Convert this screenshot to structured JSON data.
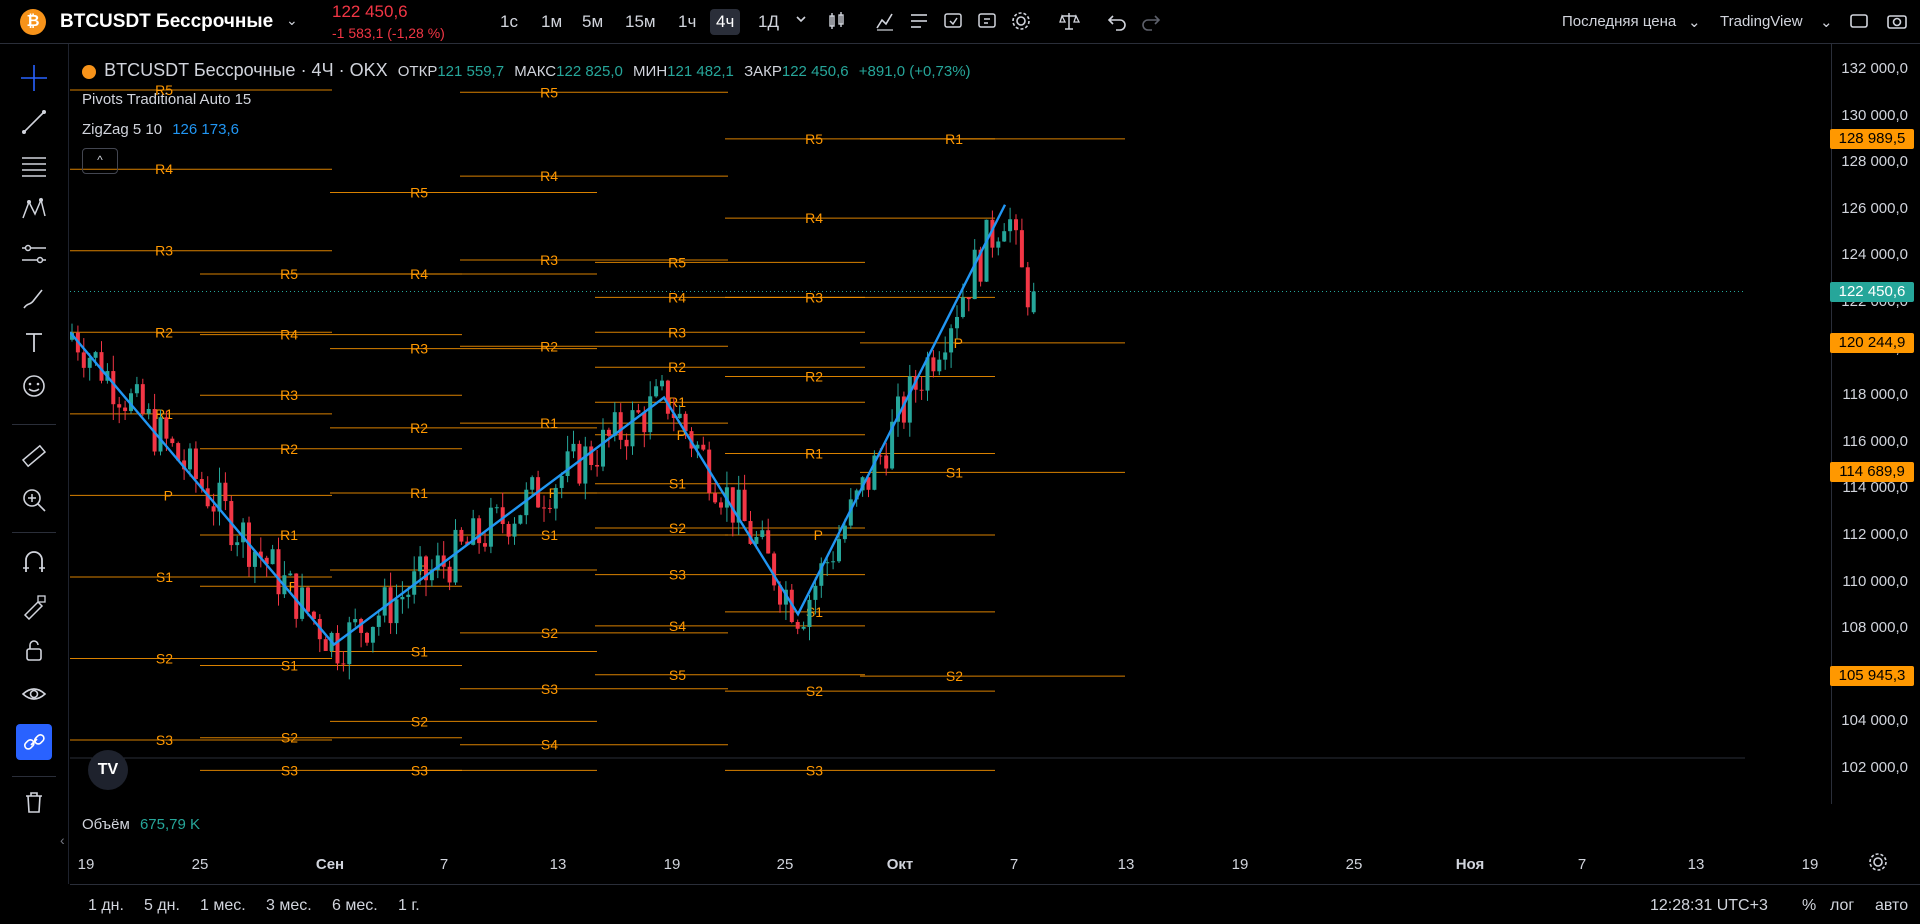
{
  "header": {
    "symbol_logo": "₿",
    "symbol_name": "BTCUSDT Бессрочные",
    "last_price": "122 450,6",
    "change": "-1 583,1 (-1,28 %)",
    "timeframes": [
      "1с",
      "1м",
      "5м",
      "15м",
      "1ч",
      "4ч",
      "1Д"
    ],
    "active_timeframe": "4ч",
    "price_type": "Последняя цена",
    "source": "TradingView"
  },
  "legend": {
    "title": "BTCUSDT Бессрочные · 4Ч · OKX",
    "open_label": "ОТКР",
    "open": "121 559,7",
    "high_label": "МАКС",
    "high": "122 825,0",
    "low_label": "МИН",
    "low": "121 482,1",
    "close_label": "ЗАКР",
    "close": "122 450,6",
    "change": "+891,0 (+0,73%)",
    "pivots": "Pivots Traditional Auto 15",
    "zigzag": "ZigZag 5 10",
    "zigzag_value": "126 173,6",
    "collapse": "^"
  },
  "volume": {
    "label": "Объём",
    "value": "675,79 K"
  },
  "price_axis": {
    "ticks": [
      "132 000,0",
      "130 000,0",
      "128 000,0",
      "126 000,0",
      "124 000,0",
      "122 000,0",
      "120 000,0",
      "118 000,0",
      "116 000,0",
      "114 000,0",
      "112 000,0",
      "110 000,0",
      "108 000,0",
      "106 000,0",
      "104 000,0",
      "102 000,0"
    ],
    "badges": [
      {
        "text": "128 989,5",
        "color": "#ff9800"
      },
      {
        "text": "122 450,6",
        "color": "#26a69a"
      },
      {
        "text": "120 244,9",
        "color": "#ff9800"
      },
      {
        "text": "114 689,9",
        "color": "#ff9800"
      },
      {
        "text": "105 945,3",
        "color": "#ff9800"
      }
    ]
  },
  "time_axis": [
    "19",
    "25",
    "Сен",
    "7",
    "13",
    "19",
    "25",
    "Окт",
    "7",
    "13",
    "19",
    "25",
    "Ноя",
    "7",
    "13",
    "19"
  ],
  "ranges": [
    "1 дн.",
    "5 дн.",
    "1 мес.",
    "3 мес.",
    "6 мес.",
    "1 г."
  ],
  "clock": "12:28:31 UTC+3",
  "scale_buttons": {
    "percent": "%",
    "log": "лог",
    "auto": "авто"
  },
  "tv_logo": "TV",
  "colors": {
    "up": "#26a69a",
    "down": "#f23645",
    "pivot": "#ff9800",
    "zigzag": "#2196f3",
    "badge_last": "#26a69a"
  },
  "chart_data": {
    "type": "candlestick",
    "timeframe": "4ч",
    "ylim": [
      101000,
      133000
    ],
    "pivot_labels": [
      "R5",
      "R4",
      "R3",
      "R2",
      "R1",
      "P",
      "S1",
      "S2",
      "S3",
      "S4",
      "S5"
    ],
    "zigzag": [
      {
        "date": "16 Авг",
        "y": 120700
      },
      {
        "date": "1 Сен",
        "y": 107300
      },
      {
        "date": "18 Сен",
        "y": 117900
      },
      {
        "date": "25 Сен",
        "y": 108600
      },
      {
        "date": "6 Окт",
        "y": 126173.6
      }
    ],
    "pivot_periods": [
      {
        "levels": {
          "R5": 131100,
          "R4": 127700,
          "R3": 124200,
          "R2": 120700,
          "R1": 117200,
          "P": 113700,
          "S1": 110200,
          "S2": 106700,
          "S3": 103200
        }
      },
      {
        "levels": {
          "R5": 123200,
          "R4": 120600,
          "R3": 118000,
          "R2": 115700,
          "R1": 112000,
          "P": 109800,
          "S1": 106400,
          "S2": 103300,
          "S3": 101900
        }
      },
      {
        "levels": {
          "R5": 126700,
          "R4": 123200,
          "R3": 120000,
          "R2": 116600,
          "R1": 113800,
          "P": 110500,
          "S1": 107000,
          "S2": 104000,
          "S3": 101900
        }
      },
      {
        "levels": {
          "R5": 131000,
          "R4": 127400,
          "R3": 123800,
          "R2": 120100,
          "R1": 116800,
          "P": 113800,
          "S1": 112000,
          "S2": 107800,
          "S3": 105400,
          "S4": 103000
        }
      },
      {
        "levels": {
          "R5": 123700,
          "R4": 122200,
          "R3": 120700,
          "R2": 119200,
          "R1": 117700,
          "P": 116300,
          "S1": 114200,
          "S2": 112300,
          "S3": 110300,
          "S4": 108100,
          "S5": 106000
        }
      },
      {
        "levels": {
          "R5": 129000,
          "R4": 125600,
          "R3": 122200,
          "R2": 118800,
          "R1": 115500,
          "P": 112000,
          "S1": 108700,
          "S2": 105300,
          "S3": 101900
        }
      },
      {
        "levels": {
          "R1": 129000,
          "P": 120245,
          "S1": 114690,
          "S2": 105945
        }
      }
    ],
    "last_close": 122450.6
  }
}
